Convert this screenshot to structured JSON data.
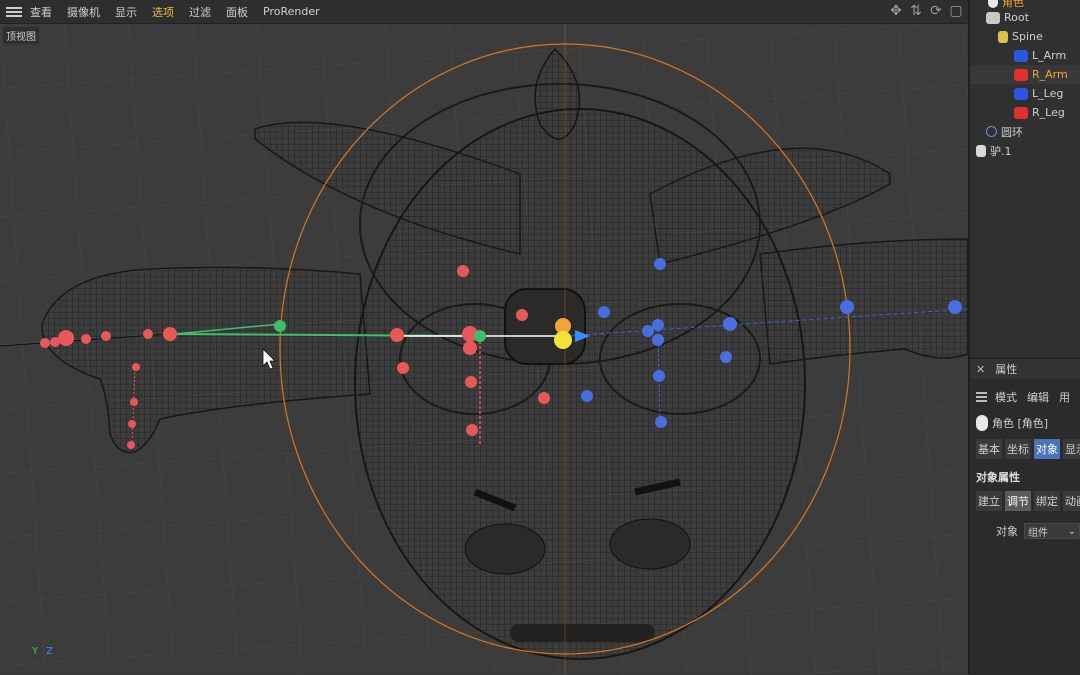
{
  "menu": {
    "items": [
      "查看",
      "摄像机",
      "显示",
      "选项",
      "过滤",
      "面板",
      "ProRender"
    ],
    "active": "选项"
  },
  "viewport": {
    "label": "顶视图",
    "axis_y": "Y",
    "axis_z": "Z"
  },
  "object_tree": {
    "items": [
      {
        "name": "角色",
        "color": "#f5a338",
        "icon": "character-icon"
      },
      {
        "name": "Root",
        "color": "#d0d0d0",
        "icon": "joint-root-icon"
      },
      {
        "name": "Spine",
        "color": "#d0d0d0",
        "icon": "spine-icon"
      },
      {
        "name": "L_Arm",
        "color": "#d0d0d0",
        "icon": "arm-blue-icon"
      },
      {
        "name": "R_Arm",
        "color": "#f5a338",
        "icon": "arm-red-icon"
      },
      {
        "name": "L_Leg",
        "color": "#d0d0d0",
        "icon": "leg-blue-icon"
      },
      {
        "name": "R_Leg",
        "color": "#d0d0d0",
        "icon": "leg-red-icon"
      },
      {
        "name": "圆环",
        "color": "#d0d0d0",
        "icon": "circle-icon"
      },
      {
        "name": "驴.1",
        "color": "#d0d0d0",
        "icon": "mesh-icon"
      }
    ]
  },
  "attributes": {
    "header": "属性",
    "menu": [
      "模式",
      "编辑",
      "用"
    ],
    "object_title": "角色 [角色]",
    "tabs": [
      "基本",
      "坐标",
      "对象",
      "显示"
    ],
    "active_tab": "对象",
    "section_title": "对象属性",
    "subtabs": [
      "建立",
      "调节",
      "绑定",
      "动画"
    ],
    "active_subtab": "调节",
    "field_label": "对象",
    "field_value": "组件"
  },
  "colors": {
    "accent_orange": "#f5a338",
    "selection_blue": "#4a73b8",
    "joint_red": "#e85858",
    "joint_blue": "#4a6ee0",
    "joint_green": "#3fbf6a"
  }
}
